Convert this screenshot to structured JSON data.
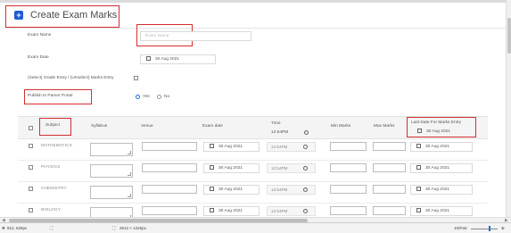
{
  "header": {
    "title": "Create Exam Marks",
    "add_icon": "plus-icon"
  },
  "form": {
    "exam_name_label": "Exam Name",
    "exam_name_placeholder": "Exam Name",
    "exam_date_label": "Exam Date",
    "exam_date_value": "30 Aug 2021",
    "grade_entry_label": "(Select) Grade Entry / (Unselect) Marks Entry",
    "publish_label": "Publish to Parent Portal",
    "publish_yes": "Yes",
    "publish_no": "No"
  },
  "table": {
    "headers": {
      "subject": "Subject",
      "syllabus": "Syllabus",
      "venue": "Venue",
      "exam_date": "Exam date",
      "time": "Time",
      "time_value": "12:54PM",
      "min_marks": "Min Marks",
      "max_marks": "Max Marks",
      "last_date": "Last Date For Marks Entry",
      "last_date_value": "30 Aug 2021"
    },
    "rows": [
      {
        "subject": "MATHEMATICS",
        "date": "30 Aug 2021",
        "time": "12:54PM",
        "last_date": "30 Aug 2021"
      },
      {
        "subject": "PHYSICS",
        "date": "30 Aug 2021",
        "time": "12:54PM",
        "last_date": "30 Aug 2021"
      },
      {
        "subject": "CHEMISTRY",
        "date": "30 Aug 2021",
        "time": "12:54PM",
        "last_date": "30 Aug 2021"
      },
      {
        "subject": "BIOLOGY",
        "date": "30 Aug 2021",
        "time": "12:54PM",
        "last_date": "30 Aug 2021"
      }
    ]
  },
  "statusbar": {
    "cursor": "812, 625px",
    "selection": "2612 × 1226px",
    "zoom": "100%"
  },
  "colors": {
    "accent": "#1e5bd8",
    "highlight_box": "#d32f2f"
  }
}
